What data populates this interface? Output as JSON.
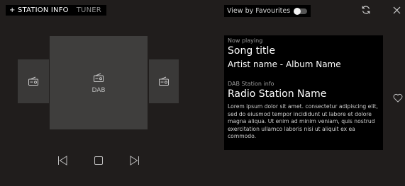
{
  "header": {
    "tabs": [
      {
        "label": "+ STATION INFO",
        "active": true
      },
      {
        "label": "TUNER",
        "active": false
      }
    ],
    "favourites_label": "View by Favourites",
    "favourites_toggle_on": false,
    "refresh_icon": "refresh-icon",
    "close_icon": "close-icon"
  },
  "carousel": {
    "items": [
      {
        "icon": "radio-icon",
        "label": ""
      },
      {
        "icon": "radio-icon",
        "label": "DAB"
      },
      {
        "icon": "radio-icon",
        "label": ""
      }
    ]
  },
  "controls": {
    "prev_icon": "skip-previous-icon",
    "stop_icon": "stop-icon",
    "next_icon": "skip-next-icon"
  },
  "now_playing": {
    "label": "Now playing",
    "song_title": "Song title",
    "artist_album": "Artist name - Album Name"
  },
  "station_info": {
    "label": "DAB Station info",
    "name": "Radio Station Name",
    "description": "Lorem ipsum dolor sit amet. consectetur adipiscing elit, sed do eiusmod tempor incididunt ut labore et dolore magna aliqua. Ut enim ad minim veniam, quis nostrud exercitation ullamco laboris nisi ut aliquit ex ea commodo."
  },
  "favourite_icon": "heart-icon",
  "colors": {
    "background": "#201d1c",
    "panel": "#000000",
    "card": "#3a3938",
    "text": "#ffffff",
    "muted": "#9a9a9a"
  }
}
